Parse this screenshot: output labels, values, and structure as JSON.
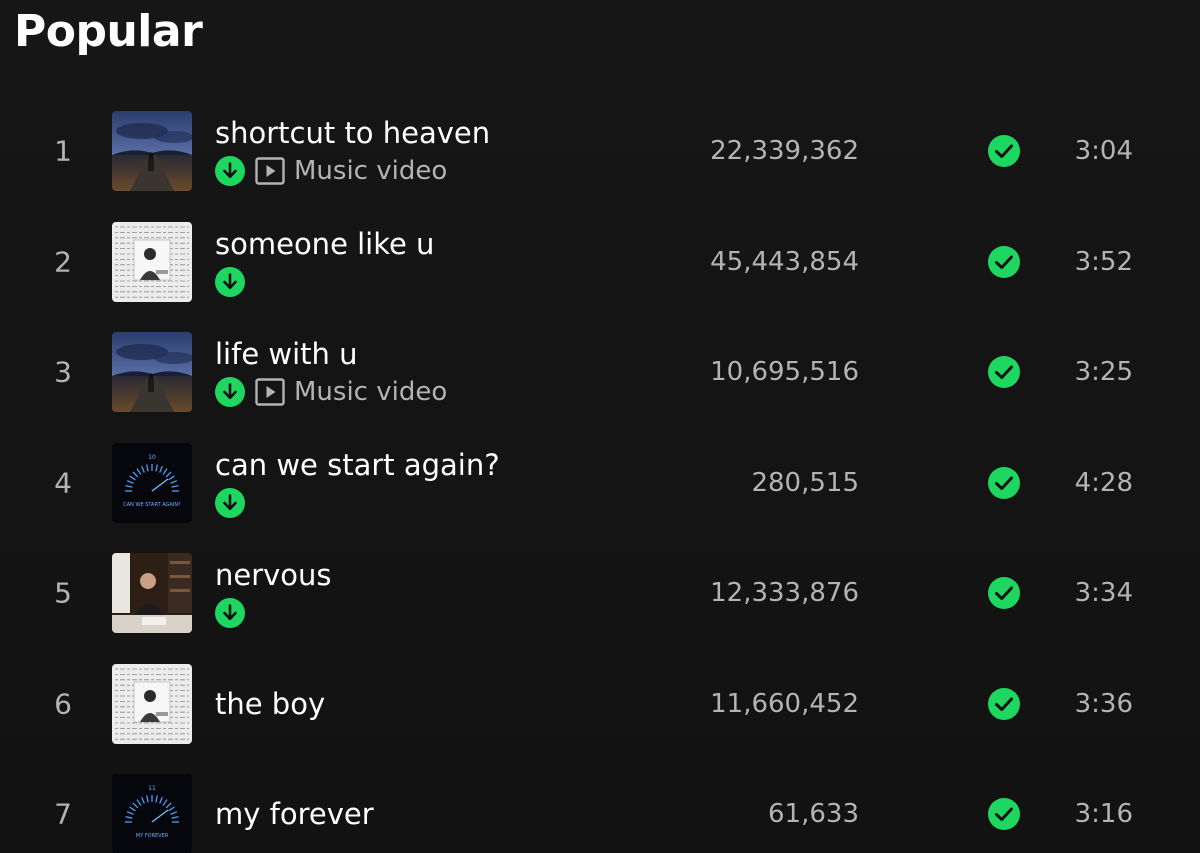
{
  "section": {
    "title": "Popular"
  },
  "colors": {
    "background": "#121212",
    "accent": "#1ed760",
    "muted": "#b3b3b3"
  },
  "icons": {
    "download": "download-arrow-circle",
    "music_video": "play-square",
    "saved": "check-circle"
  },
  "tracks": [
    {
      "index": "1",
      "title": "shortcut to heaven",
      "downloaded": true,
      "music_video": true,
      "subtitle": "Music video",
      "plays": "22,339,362",
      "saved": true,
      "duration": "3:04",
      "art": "road-night"
    },
    {
      "index": "2",
      "title": "someone like u",
      "downloaded": true,
      "music_video": false,
      "subtitle": "",
      "plays": "45,443,854",
      "saved": true,
      "duration": "3:52",
      "art": "notes-portrait"
    },
    {
      "index": "3",
      "title": "life with u",
      "downloaded": true,
      "music_video": true,
      "subtitle": "Music video",
      "plays": "10,695,516",
      "saved": true,
      "duration": "3:25",
      "art": "road-night"
    },
    {
      "index": "4",
      "title": "can we start again?",
      "downloaded": true,
      "music_video": false,
      "subtitle": "",
      "plays": "280,515",
      "saved": true,
      "duration": "4:28",
      "art": "dial-dark",
      "art_text": "CAN WE START AGAIN?",
      "art_number": "10"
    },
    {
      "index": "5",
      "title": "nervous",
      "downloaded": true,
      "music_video": false,
      "subtitle": "",
      "plays": "12,333,876",
      "saved": true,
      "duration": "3:34",
      "art": "writing-desk"
    },
    {
      "index": "6",
      "title": "the boy",
      "downloaded": false,
      "music_video": false,
      "subtitle": "",
      "plays": "11,660,452",
      "saved": true,
      "duration": "3:36",
      "art": "notes-portrait"
    },
    {
      "index": "7",
      "title": "my forever",
      "downloaded": false,
      "music_video": false,
      "subtitle": "",
      "plays": "61,633",
      "saved": true,
      "duration": "3:16",
      "art": "dial-dark",
      "art_text": "MY FOREVER",
      "art_number": "11"
    }
  ]
}
